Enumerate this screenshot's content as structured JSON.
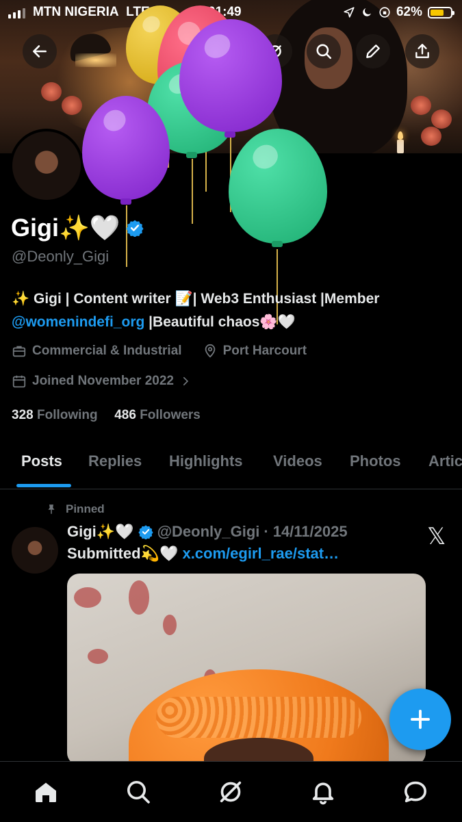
{
  "status_bar": {
    "carrier": "MTN NIGERIA",
    "network": "LTE",
    "time": "01:49",
    "battery_percent": "62%"
  },
  "header": {
    "back_icon": "arrow-left-icon",
    "grok_icon": "grok-icon",
    "search_icon": "search-icon",
    "edit_icon": "pencil-icon",
    "share_icon": "share-icon"
  },
  "profile": {
    "name": "Gigi✨🤍",
    "handle": "@Deonly_Gigi",
    "bio_line1": "✨ Gigi | Content writer 📝| Web3 Enthusiast |Member",
    "bio_link": "@womenindefi_org",
    "bio_line2_rest": " |Beautiful chaos🌸🤍",
    "category": "Commercial & Industrial",
    "location": "Port Harcourt",
    "joined": "Joined November 2022",
    "following_count": "328",
    "following_label": "Following",
    "followers_count": "486",
    "followers_label": "Followers",
    "verified_color": "#1d9bf0"
  },
  "tabs": [
    {
      "label": "Posts",
      "active": true
    },
    {
      "label": "Replies",
      "active": false
    },
    {
      "label": "Highlights",
      "active": false
    },
    {
      "label": "Videos",
      "active": false
    },
    {
      "label": "Photos",
      "active": false
    },
    {
      "label": "Articles",
      "active": false
    }
  ],
  "pinned_post": {
    "pinned_label": "Pinned",
    "author_name": "Gigi✨🤍",
    "author_handle": "@Deonly_Gigi",
    "separator": "·",
    "date": "14/11/2025",
    "text": "Submitted💫🤍 ",
    "link": "x.com/egirl_rae/stat…",
    "source_icon": "x-logo-icon",
    "x_logo": "𝕏"
  },
  "fab": {
    "icon": "plus-icon"
  },
  "bottom_nav": [
    {
      "name": "home",
      "icon": "home-icon"
    },
    {
      "name": "search",
      "icon": "search-icon"
    },
    {
      "name": "grok",
      "icon": "grok-icon"
    },
    {
      "name": "notifications",
      "icon": "bell-icon"
    },
    {
      "name": "messages",
      "icon": "chat-bubble-icon"
    }
  ],
  "colors": {
    "accent": "#1d9bf0",
    "background": "#000000",
    "muted_text": "#71767b",
    "primary_text": "#e7e9ea"
  }
}
